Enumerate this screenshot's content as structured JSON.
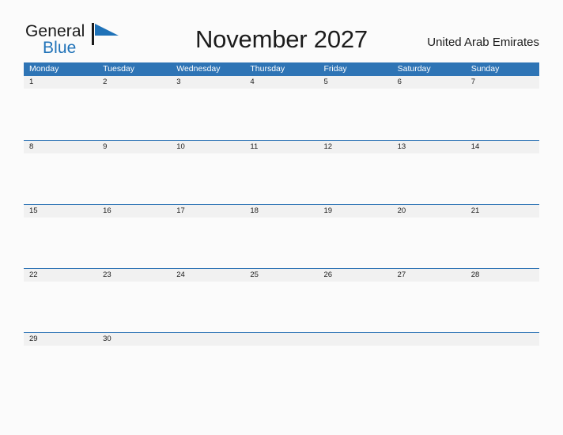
{
  "brand": {
    "name_top": "General",
    "name_bottom": "Blue",
    "mark_icon": "flag-triangle-icon",
    "accent_color": "#1f72b8"
  },
  "header": {
    "title": "November 2027",
    "region": "United Arab Emirates"
  },
  "calendar": {
    "month": "November",
    "year": "2027",
    "header_bg_color": "#2e74b5",
    "date_band_color": "#f1f1f1",
    "rule_color": "#2e74b5",
    "weekdays": [
      "Monday",
      "Tuesday",
      "Wednesday",
      "Thursday",
      "Friday",
      "Saturday",
      "Sunday"
    ],
    "weeks": [
      [
        "1",
        "2",
        "3",
        "4",
        "5",
        "6",
        "7"
      ],
      [
        "8",
        "9",
        "10",
        "11",
        "12",
        "13",
        "14"
      ],
      [
        "15",
        "16",
        "17",
        "18",
        "19",
        "20",
        "21"
      ],
      [
        "22",
        "23",
        "24",
        "25",
        "26",
        "27",
        "28"
      ],
      [
        "29",
        "30",
        "",
        "",
        "",
        "",
        ""
      ]
    ]
  }
}
